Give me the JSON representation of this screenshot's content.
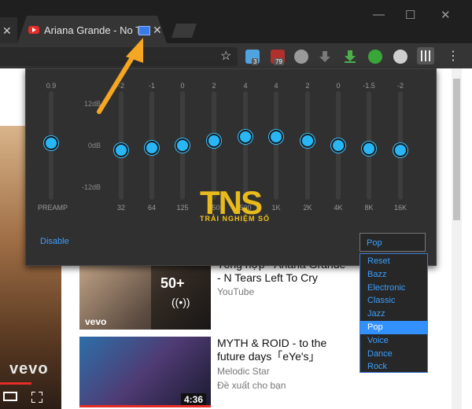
{
  "browser": {
    "tab_title": "Ariana Grande - No Te",
    "tab_close": "✕",
    "prev_tab_close": "✕",
    "window_controls": [
      "—",
      "☐",
      "✕"
    ],
    "bookmark_star": "☆",
    "extensions": [
      {
        "icon": "ghost-icon",
        "color": "#4fa3e0",
        "badge": "3"
      },
      {
        "icon": "ublock-icon",
        "color": "#b0302b",
        "badge": "79"
      },
      {
        "icon": "globe-icon",
        "color": "#9a9a9a",
        "badge": ""
      },
      {
        "icon": "download-gray-icon",
        "color": "#7a7a7a",
        "badge": ""
      },
      {
        "icon": "download-green-icon",
        "color": "#4cae4c",
        "badge": ""
      },
      {
        "icon": "green-circle-icon",
        "color": "#3aa63a",
        "badge": ""
      },
      {
        "icon": "cloud-icon",
        "color": "#cfcfcf",
        "badge": ""
      },
      {
        "icon": "equalizer-icon",
        "color": "#e0e0e0",
        "badge": ""
      }
    ],
    "menu": "⋮"
  },
  "equalizer": {
    "scale_labels": [
      "12dB",
      "0dB",
      "-12dB"
    ],
    "bands": [
      {
        "label": "PREAMP",
        "value": "0.9",
        "level": 0.9
      },
      {
        "label": "32",
        "value": "-2",
        "level": -2
      },
      {
        "label": "64",
        "value": "-1",
        "level": -1
      },
      {
        "label": "125",
        "value": "0",
        "level": 0
      },
      {
        "label": "250",
        "value": "2",
        "level": 2
      },
      {
        "label": "500",
        "value": "4",
        "level": 4
      },
      {
        "label": "1K",
        "value": "4",
        "level": 4
      },
      {
        "label": "2K",
        "value": "2",
        "level": 2
      },
      {
        "label": "4K",
        "value": "0",
        "level": 0
      },
      {
        "label": "8K",
        "value": "-1.5",
        "level": -1.5
      },
      {
        "label": "16K",
        "value": "-2",
        "level": -2
      }
    ],
    "disable_label": "Disable",
    "preset_selected": "Pop",
    "presets": [
      "Reset",
      "Bazz",
      "Electronic",
      "Classic",
      "Jazz",
      "Pop",
      "Voice",
      "Dance",
      "Rock"
    ]
  },
  "watermark": {
    "main": "TNS",
    "sub": "TRẢI NGHIỆM SỐ"
  },
  "videos": [
    {
      "title": "Tổng hợp - Ariana Grande - N Tears Left To Cry",
      "channel": "YouTube",
      "meta": "",
      "overlay_count": "50+",
      "overlay_icon": "((•))",
      "logo": "vevo"
    },
    {
      "title": "MYTH & ROID - to the future days「eYe's」",
      "channel": "Melodic Star",
      "meta": "Đề xuất cho bạn",
      "duration": "4:36"
    }
  ],
  "player": {
    "logo": "vevo"
  }
}
